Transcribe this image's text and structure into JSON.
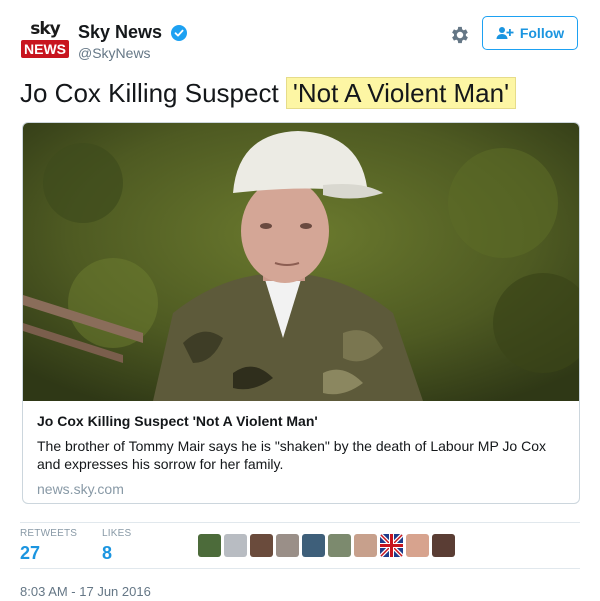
{
  "account": {
    "logo_top": "sky",
    "logo_bottom": "NEWS",
    "name": "Sky News",
    "handle": "@SkyNews",
    "verified": true
  },
  "actions": {
    "follow_label": "Follow",
    "settings_icon": "gear-icon",
    "follow_icon": "add-user-icon"
  },
  "tweet": {
    "text_plain": "Jo Cox Killing Suspect",
    "text_highlight": "'Not A Violent Man'"
  },
  "card": {
    "title": "Jo Cox Killing Suspect 'Not A Violent Man'",
    "description": "The brother of Tommy Mair says he is \"shaken\" by the death of Labour MP Jo Cox and expresses his sorrow for her family.",
    "domain": "news.sky.com"
  },
  "stats": {
    "retweets_label": "RETWEETS",
    "retweets_value": "27",
    "likes_label": "LIKES",
    "likes_value": "8"
  },
  "timestamp": "8:03 AM - 17 Jun 2016",
  "colors": {
    "accent": "#1da1f2",
    "highlight": "#fdf6a4",
    "brand_red": "#c8141e"
  }
}
